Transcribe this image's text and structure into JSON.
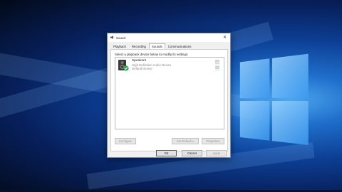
{
  "window": {
    "title": "Sound",
    "close_glyph": "✕"
  },
  "tabs": [
    "Playback",
    "Recording",
    "Sounds",
    "Communications"
  ],
  "active_tab": "Sounds",
  "instruction": "Select a playback device below to modify its settings:",
  "devices": [
    {
      "name": "Speakers",
      "description": "High Definition Audio Device",
      "status": "Default Device",
      "icon": "speaker-icon",
      "status_icon": "check-icon"
    }
  ],
  "buttons": {
    "configure": "Configure",
    "set_default": "Set Default",
    "set_default_arrow": "▾",
    "properties": "Properties",
    "ok": "OK",
    "cancel": "Cancel",
    "apply": "Apply"
  },
  "colors": {
    "check_badge": "#2fa84f",
    "focus_border": "#0078d7"
  }
}
